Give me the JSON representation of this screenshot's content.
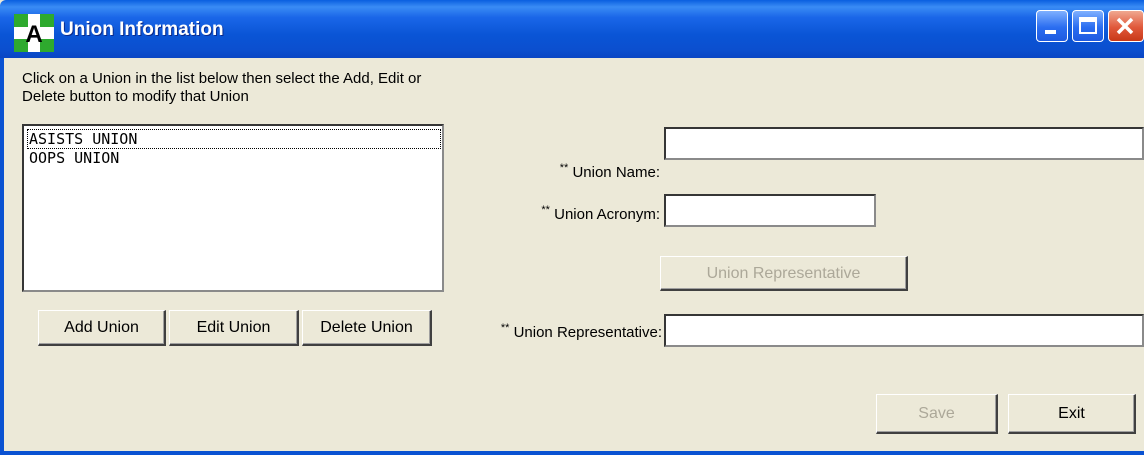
{
  "window": {
    "title": "Union Information",
    "icon": "app-a-cross-icon"
  },
  "instructions": "Click on a Union in the list below then select the Add, Edit or Delete button to modify that Union",
  "unions": [
    "ASISTS UNION",
    "OOPS UNION"
  ],
  "list_buttons": {
    "add": "Add Union",
    "edit": "Edit Union",
    "delete": "Delete Union"
  },
  "form": {
    "required_marker": "**",
    "union_name_label": "Union Name:",
    "union_name_value": "",
    "union_acronym_label": "Union Acronym:",
    "union_acronym_value": "",
    "union_rep_button": "Union Representative",
    "union_rep_label": "Union Representative:",
    "union_rep_value": ""
  },
  "footer": {
    "save": "Save",
    "exit": "Exit"
  },
  "colors": {
    "titlebar": "#0a55d6",
    "face": "#ece9d8",
    "close": "#e0583a"
  }
}
